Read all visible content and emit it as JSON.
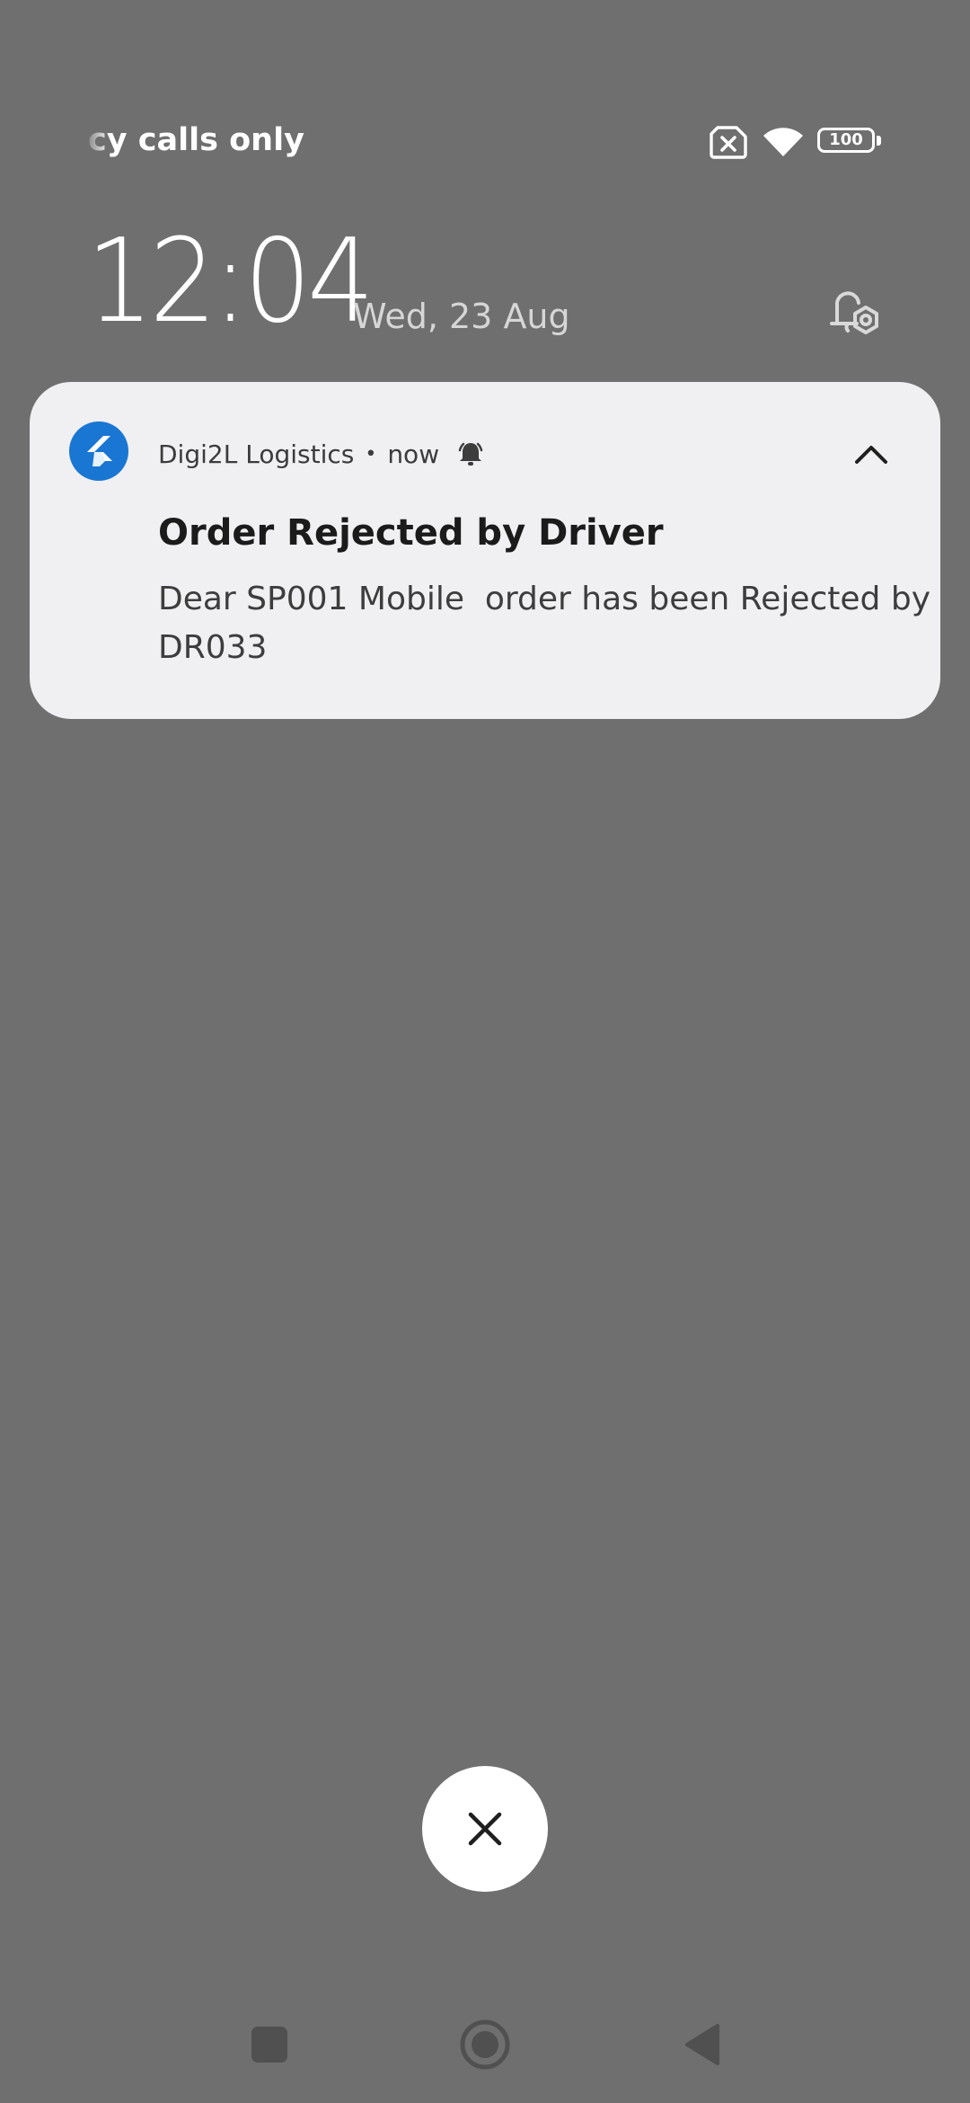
{
  "status_bar": {
    "carrier_text": "cy calls only",
    "icons": [
      "no-sim-icon",
      "wifi-icon",
      "battery-icon"
    ],
    "battery_level": "100"
  },
  "lock_screen": {
    "time": "12:04",
    "date": "Wed, 23 Aug",
    "settings_icon": "notification-settings-icon"
  },
  "notification": {
    "app_name": "Digi2L Logistics",
    "separator": "•",
    "time": "now",
    "title": "Order Rejected by Driver",
    "body": "Dear SP001 Mobile  order has been Rejected by DR033",
    "app_icon": "flutter-app-icon",
    "alert_icon": "bell-icon",
    "expand_icon": "chevron-up-icon",
    "app_icon_color": "#1976d2"
  },
  "clear_button": {
    "icon": "close-icon"
  },
  "navigation": {
    "buttons": [
      "recents-button",
      "home-button",
      "back-button"
    ]
  },
  "colors": {
    "background": "#6f6f6f",
    "card": "#f0eff2"
  }
}
